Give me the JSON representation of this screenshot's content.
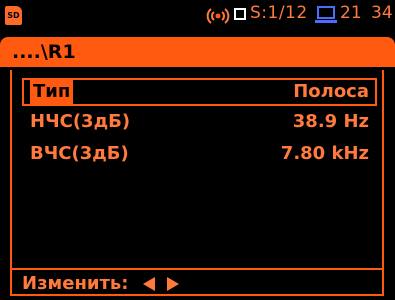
{
  "status": {
    "sd_label": "SD",
    "session": "S:1/12",
    "time": "21 34"
  },
  "path": {
    "title": "....\\R1"
  },
  "rows": [
    {
      "label": "Тип",
      "value": "Полоса"
    },
    {
      "label": "НЧС(3дБ)",
      "value": "38.9 Hz"
    },
    {
      "label": "ВЧС(3дБ)",
      "value": "7.80 kHz"
    }
  ],
  "footer": {
    "label": "Изменить:"
  },
  "colors": {
    "accent": "#ff5a10",
    "text": "#ff7a3c",
    "background": "#000000"
  }
}
